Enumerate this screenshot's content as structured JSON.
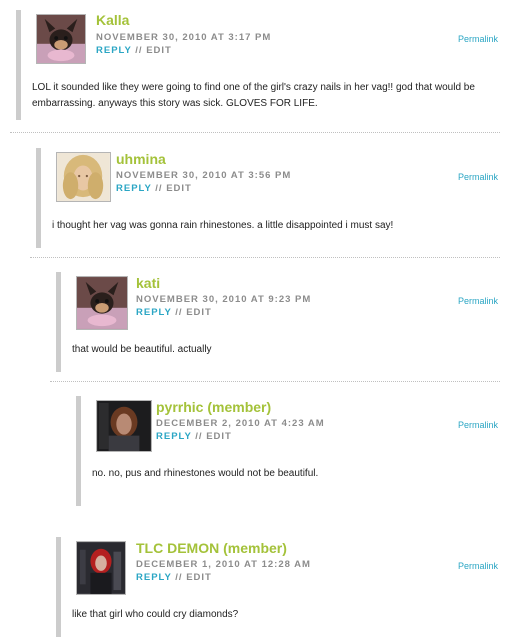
{
  "comments": [
    {
      "author": "Kalla",
      "date": "NOVEMBER 30, 2010 AT 3:17 PM",
      "reply": "REPLY",
      "separator": "//",
      "edit": "EDIT",
      "permalink": "Permalink",
      "body": "LOL it sounded like they were going to find one of the girl's crazy nails in her vag!! god that would be embarrassing. anyways this story was sick. GLOVES FOR LIFE."
    },
    {
      "author": "uhmina",
      "date": "NOVEMBER 30, 2010 AT 3:56 PM",
      "reply": "REPLY",
      "separator": "//",
      "edit": "EDIT",
      "permalink": "Permalink",
      "body": "i thought her vag was gonna rain rhinestones. a little disappointed i must say!"
    },
    {
      "author": "kati",
      "date": "NOVEMBER 30, 2010 AT 9:23 PM",
      "reply": "REPLY",
      "separator": "//",
      "edit": "EDIT",
      "permalink": "Permalink",
      "body": "that would be beautiful. actually"
    },
    {
      "author": "pyrrhic (member)",
      "date": "DECEMBER 2, 2010 AT 4:23 AM",
      "reply": "REPLY",
      "separator": "//",
      "edit": "EDIT",
      "permalink": "Permalink",
      "body": "no. no, pus and rhinestones would not be beautiful."
    },
    {
      "author": "TLC DEMON (member)",
      "date": "DECEMBER 1, 2010 AT 12:28 AM",
      "reply": "REPLY",
      "separator": "//",
      "edit": "EDIT",
      "permalink": "Permalink",
      "body": "like that girl who could cry diamonds?"
    }
  ],
  "colors": {
    "author": "#a4c23a",
    "link": "#2ba6c4",
    "meta": "#8c8c8c",
    "bar": "#cccccc"
  }
}
